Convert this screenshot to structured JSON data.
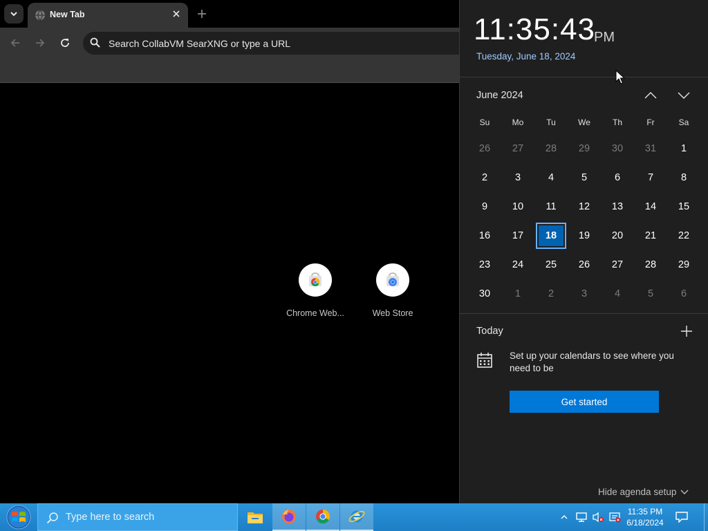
{
  "browser": {
    "tab_title": "New Tab",
    "omnibox_placeholder": "Search CollabVM SearXNG or type a URL",
    "shortcuts": [
      {
        "label": "Chrome Web..."
      },
      {
        "label": "Web Store"
      }
    ]
  },
  "flyout": {
    "time": "11:35:43",
    "ampm": "PM",
    "date": "Tuesday, June 18, 2024",
    "month_label": "June 2024",
    "weekdays": [
      "Su",
      "Mo",
      "Tu",
      "We",
      "Th",
      "Fr",
      "Sa"
    ],
    "weeks": [
      [
        {
          "d": "26",
          "o": true
        },
        {
          "d": "27",
          "o": true
        },
        {
          "d": "28",
          "o": true
        },
        {
          "d": "29",
          "o": true
        },
        {
          "d": "30",
          "o": true
        },
        {
          "d": "31",
          "o": true
        },
        {
          "d": "1"
        }
      ],
      [
        {
          "d": "2"
        },
        {
          "d": "3"
        },
        {
          "d": "4"
        },
        {
          "d": "5"
        },
        {
          "d": "6"
        },
        {
          "d": "7"
        },
        {
          "d": "8"
        }
      ],
      [
        {
          "d": "9"
        },
        {
          "d": "10"
        },
        {
          "d": "11"
        },
        {
          "d": "12"
        },
        {
          "d": "13"
        },
        {
          "d": "14"
        },
        {
          "d": "15"
        }
      ],
      [
        {
          "d": "16"
        },
        {
          "d": "17"
        },
        {
          "d": "18",
          "today": true
        },
        {
          "d": "19"
        },
        {
          "d": "20"
        },
        {
          "d": "21"
        },
        {
          "d": "22"
        }
      ],
      [
        {
          "d": "23"
        },
        {
          "d": "24"
        },
        {
          "d": "25"
        },
        {
          "d": "26"
        },
        {
          "d": "27"
        },
        {
          "d": "28"
        },
        {
          "d": "29"
        }
      ],
      [
        {
          "d": "30"
        },
        {
          "d": "1",
          "o": true
        },
        {
          "d": "2",
          "o": true
        },
        {
          "d": "3",
          "o": true
        },
        {
          "d": "4",
          "o": true
        },
        {
          "d": "5",
          "o": true
        },
        {
          "d": "6",
          "o": true
        }
      ]
    ],
    "agenda_title": "Today",
    "agenda_message": "Set up your calendars to see where you need to be",
    "get_started_label": "Get started",
    "hide_agenda_label": "Hide agenda setup"
  },
  "taskbar": {
    "search_placeholder": "Type here to search",
    "clock_time": "11:35 PM",
    "clock_date": "6/18/2024"
  },
  "colors": {
    "accent": "#0078d7",
    "today_highlight": "#0063b1",
    "taskbar": "#1d7fc6",
    "flyout_bg": "#1f1f1f"
  },
  "icons": [
    "tab-search-icon",
    "globe-icon",
    "close-icon",
    "plus-icon",
    "back-arrow-icon",
    "forward-arrow-icon",
    "reload-icon",
    "search-icon",
    "chrome-web-store-icon",
    "web-store-icon",
    "chevron-up-icon",
    "chevron-down-icon",
    "calendar-icon",
    "windows-start-icon",
    "file-explorer-icon",
    "firefox-icon",
    "chrome-icon",
    "ie-icon",
    "network-icon",
    "volume-muted-icon",
    "action-center-icon",
    "notification-icon",
    "tray-overflow-icon"
  ]
}
